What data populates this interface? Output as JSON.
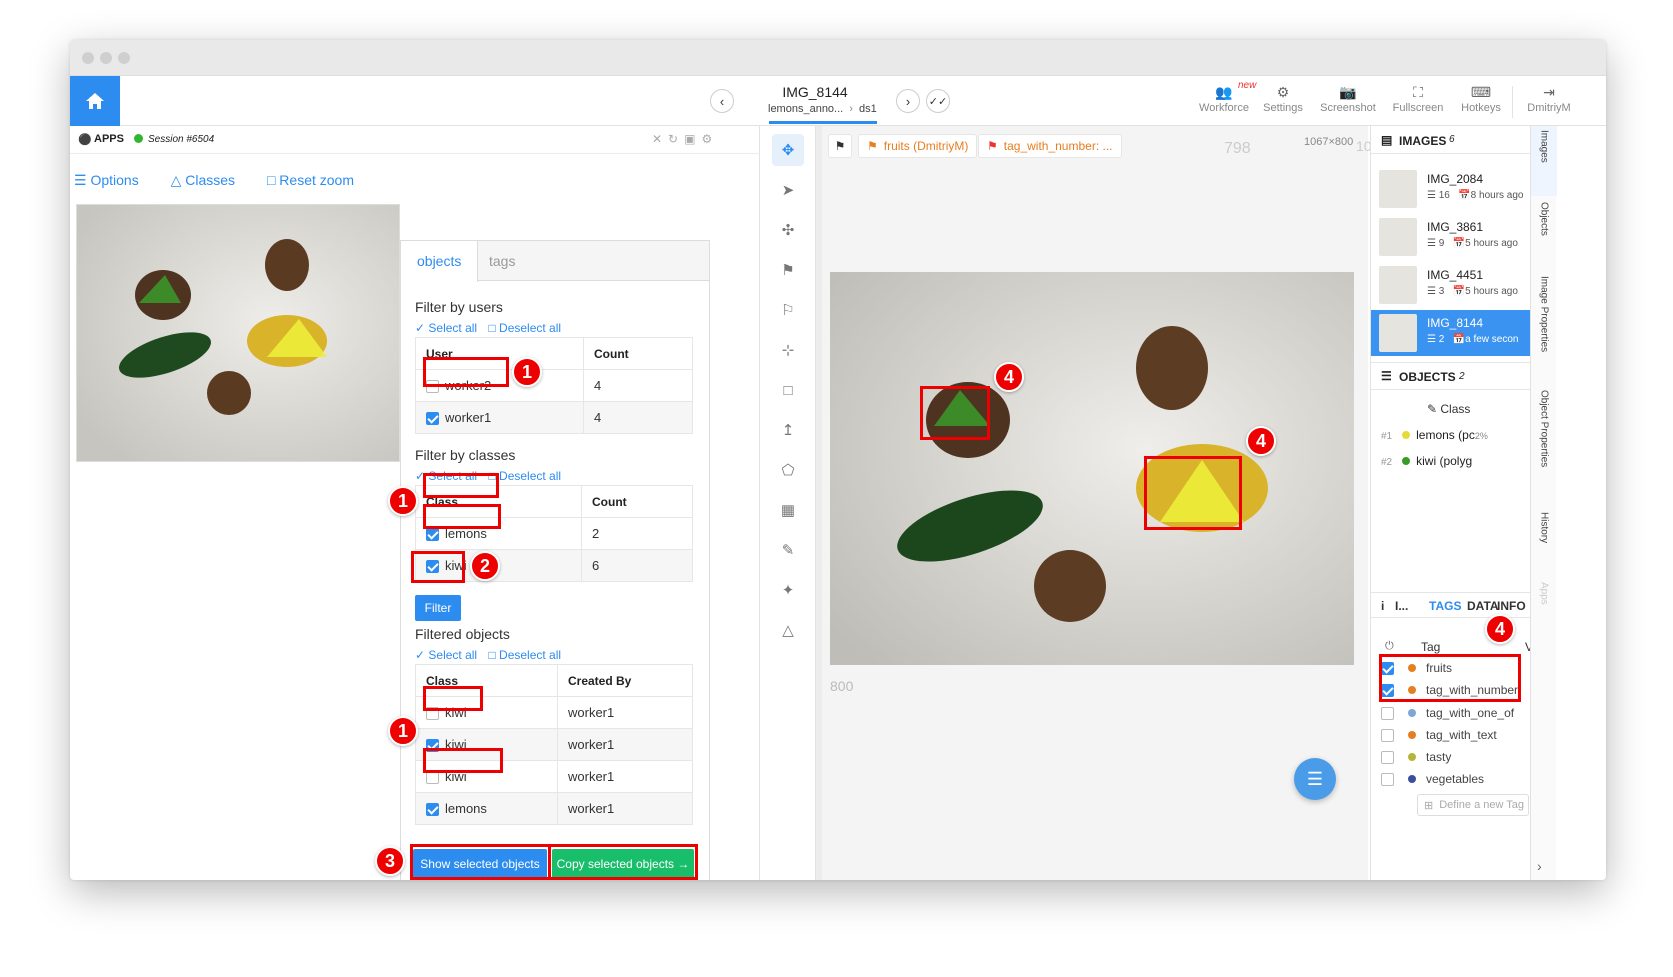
{
  "topbar": {
    "image_title": "IMG_8144",
    "image_sub": "lemons_anno...",
    "dataset": "ds1",
    "tools": [
      {
        "label": "Workforce",
        "icon": "users-icon",
        "badge": "new"
      },
      {
        "label": "Settings",
        "icon": "gear-icon"
      },
      {
        "label": "Screenshot",
        "icon": "camera-icon"
      },
      {
        "label": "Fullscreen",
        "icon": "fullscreen-icon"
      },
      {
        "label": "Hotkeys",
        "icon": "keyboard-icon"
      },
      {
        "label": "DmitriyM",
        "icon": "logout-icon"
      }
    ]
  },
  "apps": {
    "label": "APPS",
    "session": "Session #6504",
    "options": "Options",
    "classes": "Classes",
    "reset_zoom": "Reset zoom"
  },
  "card": {
    "tab_objects": "objects",
    "tab_tags": "tags",
    "filter_users_title": "Filter by users",
    "select_all": "Select all",
    "deselect_all": "Deselect all",
    "users_header": [
      "User",
      "Count"
    ],
    "users": [
      {
        "name": "worker2",
        "count": "4",
        "checked": false
      },
      {
        "name": "worker1",
        "count": "4",
        "checked": true
      }
    ],
    "filter_classes_title": "Filter by classes",
    "classes_header": [
      "Class",
      "Count"
    ],
    "classes": [
      {
        "name": "lemons",
        "count": "2",
        "checked": true
      },
      {
        "name": "kiwi",
        "count": "6",
        "checked": true
      }
    ],
    "filter_button": "Filter",
    "filtered_title": "Filtered objects",
    "filtered_header": [
      "Class",
      "Created By"
    ],
    "filtered": [
      {
        "class": "kiwi",
        "by": "worker1",
        "checked": false
      },
      {
        "class": "kiwi",
        "by": "worker1",
        "checked": true
      },
      {
        "class": "kiwi",
        "by": "worker1",
        "checked": false
      },
      {
        "class": "lemons",
        "by": "worker1",
        "checked": true
      }
    ],
    "show_button": "Show selected objects",
    "copy_button": "Copy selected objects →"
  },
  "badges": {
    "one": "1",
    "two": "2",
    "three": "3",
    "four": "4"
  },
  "canvas": {
    "chip1": "fruits (DmitriyM)",
    "chip2": "tag_with_number: ...",
    "ruler_top": "798",
    "ruler_left": "800",
    "size": "1067×800",
    "size_suffix": "10"
  },
  "right": {
    "images_title": "IMAGES",
    "images_count": "6",
    "images": [
      {
        "name": "IMG_2084",
        "count": "16",
        "time": "8 hours ago"
      },
      {
        "name": "IMG_3861",
        "count": "9",
        "time": "5 hours ago"
      },
      {
        "name": "IMG_4451",
        "count": "3",
        "time": "5 hours ago"
      },
      {
        "name": "IMG_8144",
        "count": "2",
        "time": "a few secon"
      }
    ],
    "objects_title": "OBJECTS",
    "objects_count": "2",
    "class_col": "Class",
    "objects": [
      {
        "idx": "#1",
        "label": "lemons (pc",
        "extra": "2%",
        "color": "#e8d93a"
      },
      {
        "idx": "#2",
        "label": "kiwi (polyg",
        "extra": "",
        "color": "#3a9a2a"
      }
    ],
    "info_tabs": [
      "I...",
      "TAGS",
      "DATA",
      "INFO"
    ],
    "tag_col": "Tag",
    "tag_col_v": "V",
    "tags": [
      {
        "name": "fruits",
        "color": "#e67e22",
        "checked": true
      },
      {
        "name": "tag_with_number",
        "color": "#e67e22",
        "checked": true
      },
      {
        "name": "tag_with_one_of",
        "color": "#7fa7d6",
        "checked": false
      },
      {
        "name": "tag_with_text",
        "color": "#e67e22",
        "checked": false
      },
      {
        "name": "tasty",
        "color": "#b5b53a",
        "checked": false
      },
      {
        "name": "vegetables",
        "color": "#3b4fa0",
        "checked": false
      }
    ],
    "define_tag": "Define a new Tag"
  },
  "vtabs": [
    "Images",
    "Objects",
    "Image Properties",
    "Object Properties",
    "History",
    "Apps"
  ]
}
